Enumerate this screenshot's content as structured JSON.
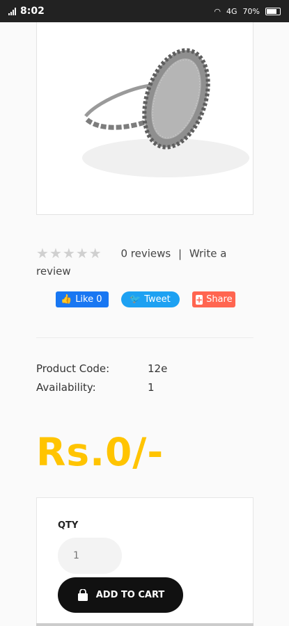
{
  "status_bar": {
    "network": "4G",
    "time": "8:02",
    "battery": "70%"
  },
  "product": {
    "image_alt": "Silver ring",
    "rating": {
      "stars": 0,
      "max": 5,
      "reviews_text": "0 reviews",
      "separator": "|",
      "write_review": "Write a review"
    },
    "social": {
      "like_label": "Like 0",
      "tweet_label": "Tweet",
      "share_label": "Share"
    },
    "details": [
      {
        "key": "Product Code:",
        "value": "12e"
      },
      {
        "key": "Availability:",
        "value": "1"
      }
    ],
    "price": "Rs.0/-",
    "qty": {
      "label": "QTY",
      "placeholder": "1"
    },
    "add_to_cart": "ADD TO CART"
  }
}
